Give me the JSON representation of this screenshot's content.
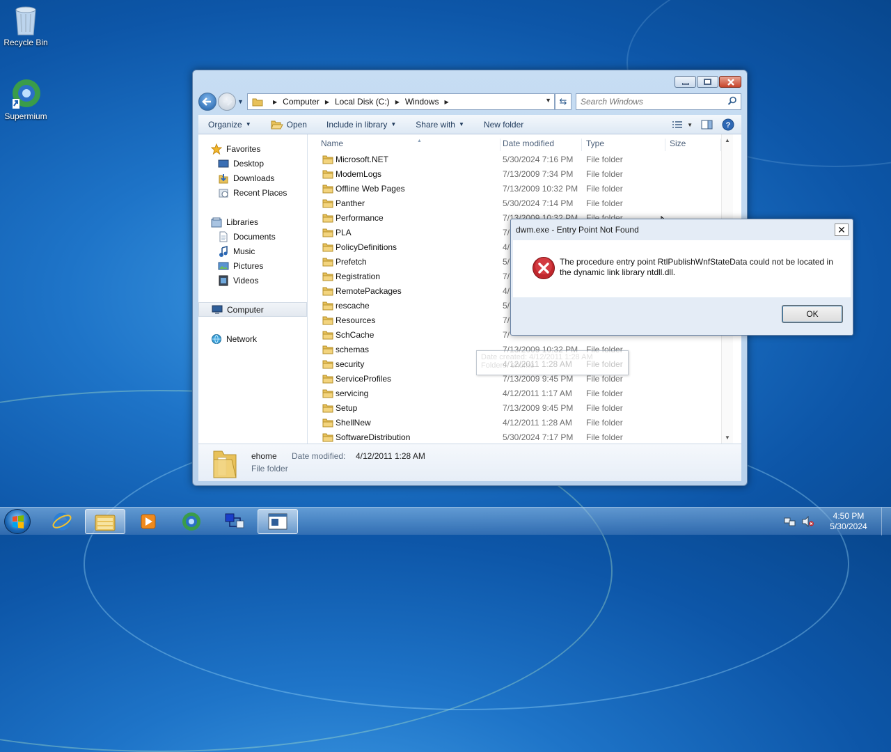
{
  "desktop": {
    "icons": [
      {
        "label": "Recycle Bin"
      },
      {
        "label": "Supermium"
      }
    ]
  },
  "explorer": {
    "breadcrumb": [
      "Computer",
      "Local Disk (C:)",
      "Windows"
    ],
    "search_placeholder": "Search Windows",
    "commands": {
      "organize": "Organize",
      "open": "Open",
      "include_in_library": "Include in library",
      "share_with": "Share with",
      "new_folder": "New folder"
    },
    "nav": {
      "favorites": "Favorites",
      "desktop": "Desktop",
      "downloads": "Downloads",
      "recent_places": "Recent Places",
      "libraries": "Libraries",
      "documents": "Documents",
      "music": "Music",
      "pictures": "Pictures",
      "videos": "Videos",
      "computer": "Computer",
      "network": "Network"
    },
    "columns": {
      "name": "Name",
      "date_modified": "Date modified",
      "type": "Type",
      "size": "Size"
    },
    "files": [
      {
        "name": "Microsoft.NET",
        "date": "5/30/2024 7:16 PM",
        "type": "File folder"
      },
      {
        "name": "ModemLogs",
        "date": "7/13/2009 7:34 PM",
        "type": "File folder"
      },
      {
        "name": "Offline Web Pages",
        "date": "7/13/2009 10:32 PM",
        "type": "File folder"
      },
      {
        "name": "Panther",
        "date": "5/30/2024 7:14 PM",
        "type": "File folder"
      },
      {
        "name": "Performance",
        "date": "7/13/2009 10:32 PM",
        "type": "File folder"
      },
      {
        "name": "PLA",
        "date": "7/",
        "type": ""
      },
      {
        "name": "PolicyDefinitions",
        "date": "4/",
        "type": ""
      },
      {
        "name": "Prefetch",
        "date": "5/",
        "type": ""
      },
      {
        "name": "Registration",
        "date": "7/",
        "type": ""
      },
      {
        "name": "RemotePackages",
        "date": "4/",
        "type": ""
      },
      {
        "name": "rescache",
        "date": "5/",
        "type": ""
      },
      {
        "name": "Resources",
        "date": "7/",
        "type": ""
      },
      {
        "name": "SchCache",
        "date": "7/",
        "type": ""
      },
      {
        "name": "schemas",
        "date": "7/13/2009 10:32 PM",
        "type": "File folder"
      },
      {
        "name": "security",
        "date": "4/12/2011 1:28 AM",
        "type": "File folder"
      },
      {
        "name": "ServiceProfiles",
        "date": "7/13/2009 9:45 PM",
        "type": "File folder"
      },
      {
        "name": "servicing",
        "date": "4/12/2011 1:17 AM",
        "type": "File folder"
      },
      {
        "name": "Setup",
        "date": "7/13/2009 9:45 PM",
        "type": "File folder"
      },
      {
        "name": "ShellNew",
        "date": "4/12/2011 1:28 AM",
        "type": "File folder"
      },
      {
        "name": "SoftwareDistribution",
        "date": "5/30/2024 7:17 PM",
        "type": "File folder"
      }
    ],
    "tooltip": {
      "line1": "Date created: 4/12/2011 1:28 AM",
      "line2": "Folders: ehome"
    },
    "details": {
      "name": "ehome",
      "date_label": "Date modified:",
      "date_value": "4/12/2011 1:28 AM",
      "type": "File folder"
    }
  },
  "dialog": {
    "title": "dwm.exe - Entry Point Not Found",
    "close": "✕",
    "message": "The procedure entry point RtlPublishWnfStateData could not be located in the dynamic link library ntdll.dll.",
    "ok_label": "OK"
  },
  "taskbar": {
    "time": "4:50 PM",
    "date": "5/30/2024"
  },
  "colors": {
    "accent": "#1d5ea7",
    "error_red": "#c0272d",
    "folder_yellow": "#e8c15a"
  }
}
